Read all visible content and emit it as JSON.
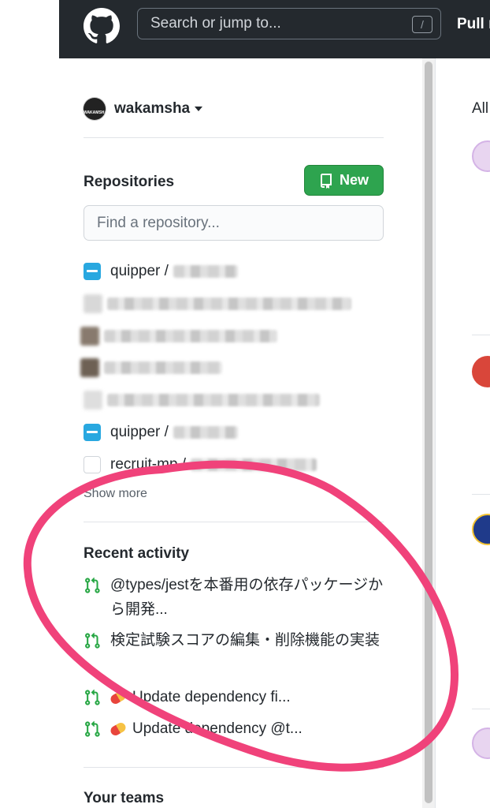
{
  "header": {
    "search_placeholder": "Search or jump to...",
    "search_shortcut": "/",
    "pull_label": "Pull r"
  },
  "user": {
    "name": "wakamsha",
    "avatar_text": "WAKAMSHA"
  },
  "repositories": {
    "title": "Repositories",
    "new_label": "New",
    "search_placeholder": "Find a repository...",
    "items": [
      {
        "owner": "quipper /",
        "icon": "org"
      },
      {
        "owner": "",
        "icon": "blurred"
      },
      {
        "owner": "",
        "icon": "blurred"
      },
      {
        "owner": "",
        "icon": "blurred"
      },
      {
        "owner": "",
        "icon": "blurred"
      },
      {
        "owner": "quipper /",
        "icon": "org"
      },
      {
        "owner": "recruit-mp /",
        "icon": "blank"
      }
    ],
    "show_more": "Show more"
  },
  "recent_activity": {
    "title": "Recent activity",
    "items": [
      {
        "text": "@types/jestを本番用の依存パッケージから開発..."
      },
      {
        "text": "検定試験スコアの編集・削除機能の実装"
      },
      {
        "text": "Update dependency fi..."
      },
      {
        "text": "Update dependency @t..."
      }
    ]
  },
  "teams": {
    "title": "Your teams"
  },
  "main": {
    "all_label": "All"
  },
  "colors": {
    "header_bg": "#24292e",
    "new_button": "#2ea44f",
    "pr_icon": "#28a745",
    "annotation": "#f0427a"
  }
}
